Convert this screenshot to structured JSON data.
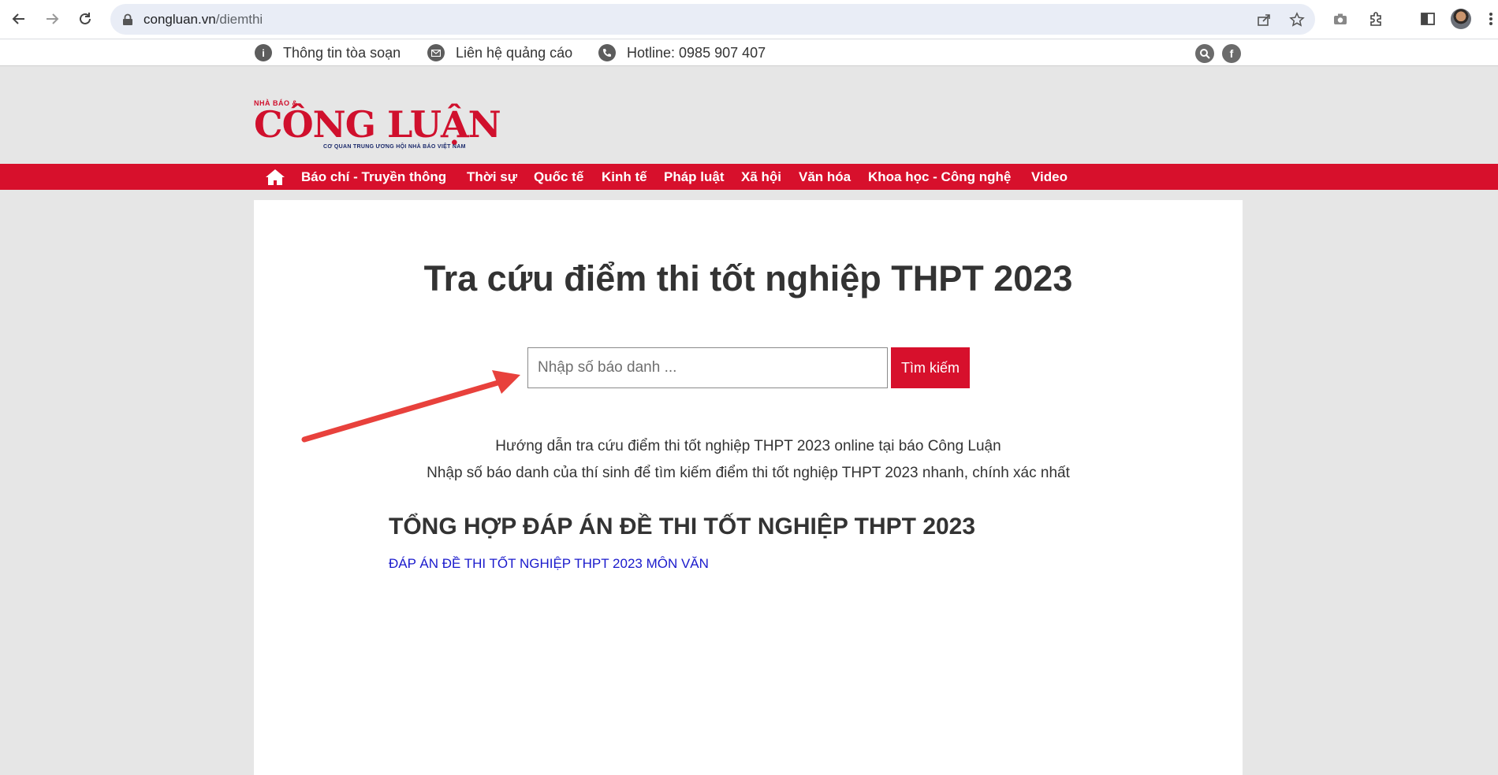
{
  "browser": {
    "url_host": "congluan.vn",
    "url_path": "/diemthi"
  },
  "topbar": {
    "items": [
      {
        "label": "Thông tin tòa soạn"
      },
      {
        "label": "Liên hệ quảng cáo"
      },
      {
        "label": "Hotline: 0985 907 407"
      }
    ]
  },
  "logo": {
    "top_text": "NHÀ BÁO &",
    "name": "CÔNG LUẬN",
    "tagline": "CƠ QUAN TRUNG ƯƠNG HỘI NHÀ BÁO VIỆT NAM"
  },
  "nav": {
    "items": [
      {
        "label": "Báo chí - Truyền thông"
      },
      {
        "label": "Thời sự"
      },
      {
        "label": "Quốc tế"
      },
      {
        "label": "Kinh tế"
      },
      {
        "label": "Pháp luật"
      },
      {
        "label": "Xã hội"
      },
      {
        "label": "Văn hóa"
      },
      {
        "label": "Khoa học - Công nghệ"
      },
      {
        "label": "Video"
      }
    ]
  },
  "main": {
    "title": "Tra cứu điểm thi tốt nghiệp THPT 2023",
    "search_placeholder": "Nhập số báo danh ...",
    "search_button": "Tìm kiếm",
    "guide_line1": "Hướng dẫn tra cứu điểm thi tốt nghiệp THPT 2023 online tại báo Công Luận",
    "guide_line2": "Nhập số báo danh của thí sinh để tìm kiếm điểm thi tốt nghiệp THPT 2023 nhanh, chính xác nhất",
    "section_title": "TỔNG HỢP ĐÁP ÁN ĐỀ THI TỐT NGHIỆP THPT 2023",
    "section_link": "ĐÁP ÁN ĐỀ THI TỐT NGHIỆP THPT 2023 MÔN VĂN"
  },
  "colors": {
    "brand_red": "#d7102c",
    "link_blue": "#1a1acc",
    "page_bg": "#e6e6e6"
  }
}
